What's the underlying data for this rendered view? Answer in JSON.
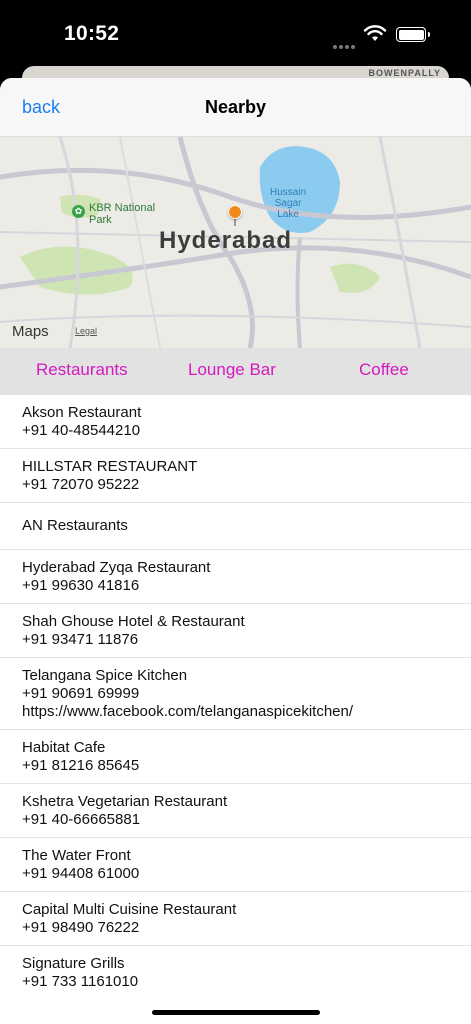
{
  "status": {
    "time": "10:52"
  },
  "background_card": {
    "label": "BOWENPALLY"
  },
  "nav": {
    "back_label": "back",
    "title": "Nearby"
  },
  "map": {
    "city_label": "Hyderabad",
    "park_label_1": "KBR National",
    "park_label_2": "Park",
    "lake_label_1": "Hussain",
    "lake_label_2": "Sagar",
    "lake_label_3": "Lake",
    "attribution": "Maps",
    "legal_label": "Legal",
    "water_color": "#8ccbf0",
    "park_color": "#cfe4b3",
    "road_color": "#c8c8d2",
    "pin_color": "#f08a1c"
  },
  "segments": [
    "Restaurants",
    "Lounge Bar",
    "Coffee"
  ],
  "accent_color": "#d41abf",
  "places": [
    {
      "name": "Akson Restaurant",
      "phone": "+91 40-48544210"
    },
    {
      "name": "HILLSTAR RESTAURANT",
      "phone": "+91 72070 95222"
    },
    {
      "name": "AN Restaurants"
    },
    {
      "name": "Hyderabad Zyqa Restaurant",
      "phone": "+91 99630 41816"
    },
    {
      "name": "Shah Ghouse Hotel & Restaurant",
      "phone": "+91 93471 11876"
    },
    {
      "name": "Telangana Spice Kitchen",
      "phone": "+91 90691 69999",
      "url": "https://www.facebook.com/telanganaspicekitchen/"
    },
    {
      "name": "Habitat Cafe",
      "phone": "+91 81216 85645"
    },
    {
      "name": "Kshetra Vegetarian Restaurant",
      "phone": "+91 40-66665881"
    },
    {
      "name": "The Water Front",
      "phone": "+91 94408 61000"
    },
    {
      "name": "Capital Multi Cuisine Restaurant",
      "phone": "+91 98490 76222"
    },
    {
      "name": "Signature Grills",
      "phone": "+91 733 1161010"
    }
  ]
}
